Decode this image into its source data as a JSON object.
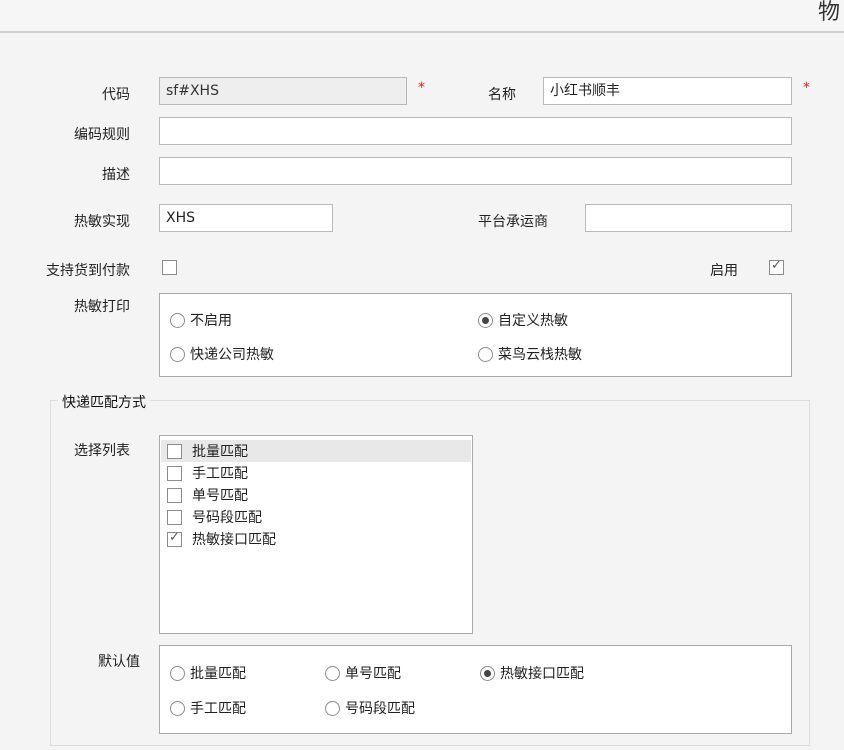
{
  "window": {
    "title": "物"
  },
  "form": {
    "code_label": "代码",
    "code_value": "sf#XHS",
    "required_mark": "*",
    "name_label": "名称",
    "name_value": "小红书顺丰",
    "encoding_rule_label": "编码规则",
    "encoding_rule_value": "",
    "description_label": "描述",
    "description_value": "",
    "thermal_impl_label": "热敏实现",
    "thermal_impl_value": "XHS",
    "platform_carrier_label": "平台承运商",
    "platform_carrier_value": "",
    "cod_label": "支持货到付款",
    "cod_checked": false,
    "enable_label": "启用",
    "enable_checked": true,
    "thermal_print_label": "热敏打印",
    "thermal_print_options": [
      "不启用",
      "自定义热敏",
      "快递公司热敏",
      "菜鸟云栈热敏"
    ],
    "thermal_print_selected": "自定义热敏"
  },
  "match_group": {
    "title": "快递匹配方式",
    "list_label": "选择列表",
    "list_items": [
      {
        "label": "批量匹配",
        "checked": false,
        "selected": true
      },
      {
        "label": "手工匹配",
        "checked": false,
        "selected": false
      },
      {
        "label": "单号匹配",
        "checked": false,
        "selected": false
      },
      {
        "label": "号码段匹配",
        "checked": false,
        "selected": false
      },
      {
        "label": "热敏接口匹配",
        "checked": true,
        "selected": false
      }
    ],
    "default_label": "默认值",
    "default_options": [
      "批量匹配",
      "单号匹配",
      "热敏接口匹配",
      "手工匹配",
      "号码段匹配"
    ],
    "default_selected": "热敏接口匹配"
  }
}
